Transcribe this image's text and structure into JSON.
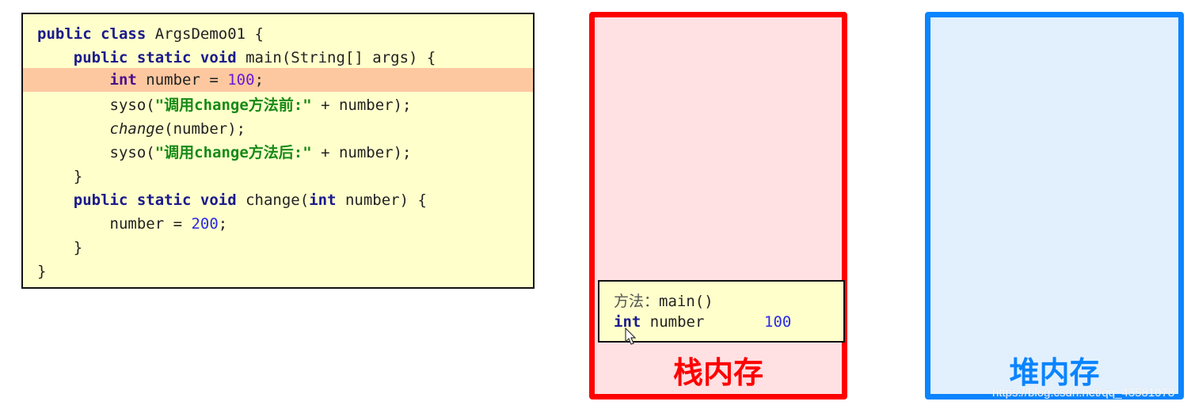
{
  "code": {
    "lines": [
      {
        "t0": "public class",
        "t1": " ArgsDemo01 {"
      },
      {
        "indent": "    ",
        "t0": "public static void",
        "t1": " main(String[] args) {"
      },
      {
        "indent": "        ",
        "t0": "int",
        "t1": " number = ",
        "t2": "100",
        "t3": ";"
      },
      {
        "indent": "        ",
        "t0": "syso(",
        "t1": "\"调用change方法前:\"",
        "t2": " + number);"
      },
      {
        "indent": "        ",
        "t0": "change",
        "t1": "(number);"
      },
      {
        "indent": "        ",
        "t0": "syso(",
        "t1": "\"调用change方法后:\"",
        "t2": " + number);"
      },
      {
        "indent": "    ",
        "t0": "}"
      },
      {
        "indent": "    ",
        "t0": "public static void",
        "t1": " change(",
        "t2": "int",
        "t3": " number) {"
      },
      {
        "indent": "        ",
        "t0": "number = ",
        "t1": "200",
        "t2": ";"
      },
      {
        "indent": "    ",
        "t0": "}"
      },
      {
        "t0": "}"
      }
    ],
    "highlight_line": 3
  },
  "stack": {
    "label": "栈内存",
    "frame": {
      "title_label": "方法：",
      "title_method": "main()",
      "var_type": "int",
      "var_name": " number",
      "var_value": "100"
    },
    "color": "#ff0000"
  },
  "heap": {
    "label": "堆内存",
    "color": "#0a84ff"
  },
  "watermark": "https://blog.csdn.net/qq_43581078"
}
